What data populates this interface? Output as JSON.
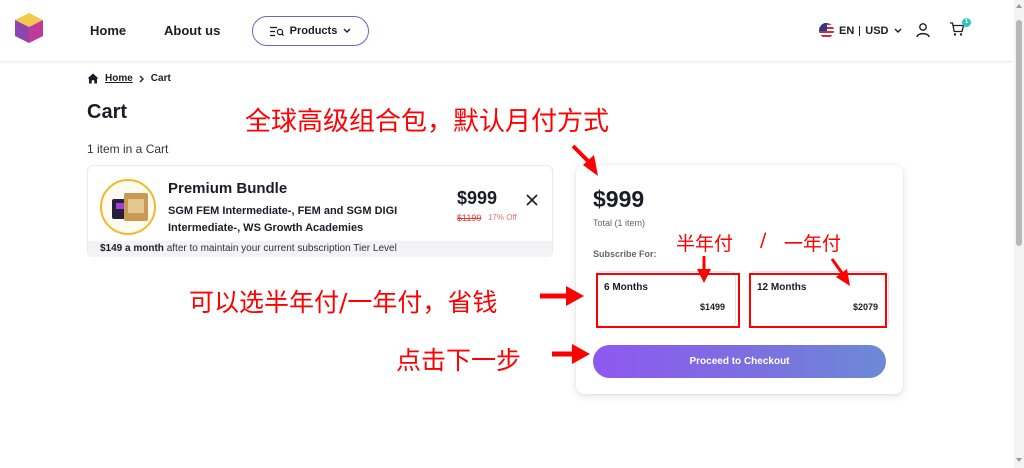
{
  "header": {
    "nav": {
      "home": "Home",
      "about": "About us",
      "products": "Products"
    },
    "locale": {
      "lang": "EN",
      "currency": "USD"
    },
    "cart_count": "1"
  },
  "breadcrumb": {
    "home": "Home",
    "current": "Cart"
  },
  "page": {
    "title": "Cart",
    "item_count": "1 item in a Cart"
  },
  "cart_item": {
    "name": "Premium Bundle",
    "description": "SGM FEM Intermediate-, FEM and SGM DIGI Intermediate-, WS Growth Academies",
    "price": "$999",
    "old_price": "$1199",
    "discount": "17% Off",
    "note_bold": "$149 a month",
    "note_rest": " after to maintain your current subscription Tier Level"
  },
  "summary": {
    "total": "$999",
    "total_label": "Total (1 item)",
    "subscribe_label": "Subscribe For:",
    "options": [
      {
        "label": "6 Months",
        "price": "$1499"
      },
      {
        "label": "12 Months",
        "price": "$2079"
      }
    ],
    "checkout": "Proceed to Checkout"
  },
  "annotations": {
    "default": "全球高级组合包，默认月付方式",
    "half_year": "半年付",
    "slash": "/",
    "one_year": "一年付",
    "save": "可以选半年付/一年付，省钱",
    "next": "点击下一步"
  },
  "colors": {
    "accent": "#6b63d9",
    "annotation": "#ff0000",
    "checkout_start": "#8e58f0",
    "checkout_end": "#6b8ad6",
    "discount": "#e53935"
  },
  "icons": [
    "cube-logo-icon",
    "products-menu-icon",
    "chevron-down-icon",
    "us-flag-icon",
    "user-icon",
    "cart-icon",
    "home-icon",
    "chevron-right-icon",
    "close-icon"
  ]
}
